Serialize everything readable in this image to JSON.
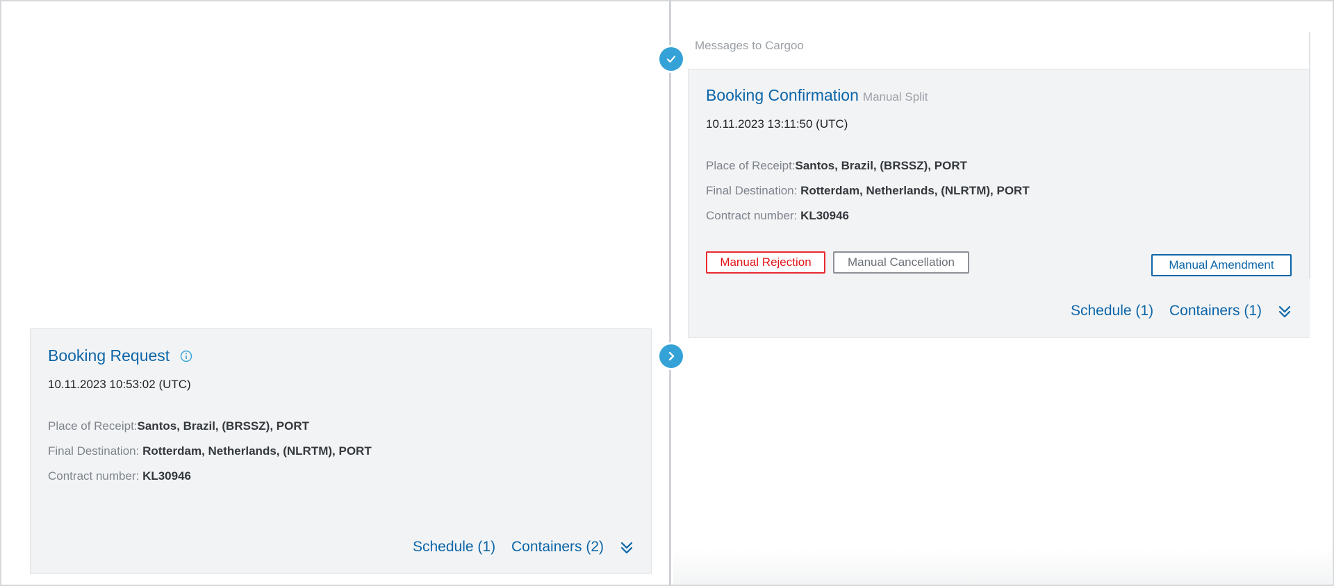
{
  "timeline": {
    "section_label": "Messages to Cargoo"
  },
  "confirmation": {
    "title": "Booking Confirmation",
    "subtitle": "Manual Split",
    "timestamp": "10.11.2023 13:11:50 (UTC)",
    "place_of_receipt_label": "Place of Receipt:",
    "place_of_receipt_value": "Santos, Brazil, (BRSSZ), PORT",
    "final_destination_label": "Final Destination: ",
    "final_destination_value": "Rotterdam, Netherlands, (NLRTM), PORT",
    "contract_label": "Contract number: ",
    "contract_value": "KL30946",
    "buttons": {
      "reject": "Manual Rejection",
      "cancel": "Manual Cancellation",
      "amend": "Manual Amendment"
    },
    "schedule_link": "Schedule (1)",
    "containers_link": "Containers (1)"
  },
  "request": {
    "title": "Booking Request",
    "timestamp": "10.11.2023 10:53:02 (UTC)",
    "place_of_receipt_label": "Place of Receipt:",
    "place_of_receipt_value": "Santos, Brazil, (BRSSZ), PORT",
    "final_destination_label": "Final Destination: ",
    "final_destination_value": "Rotterdam, Netherlands, (NLRTM), PORT",
    "contract_label": "Contract number: ",
    "contract_value": "KL30946",
    "schedule_link": "Schedule (1)",
    "containers_link": "Containers (2)"
  },
  "icons": {
    "confirmation_node": "check-icon",
    "request_node": "chevron-right-icon",
    "info": "info-icon",
    "expand": "double-chevron-down-icon"
  },
  "colors": {
    "accent": "#0b65a8",
    "node": "#35a2d7",
    "reject": "#e0141a",
    "card_bg": "#f2f3f5"
  }
}
